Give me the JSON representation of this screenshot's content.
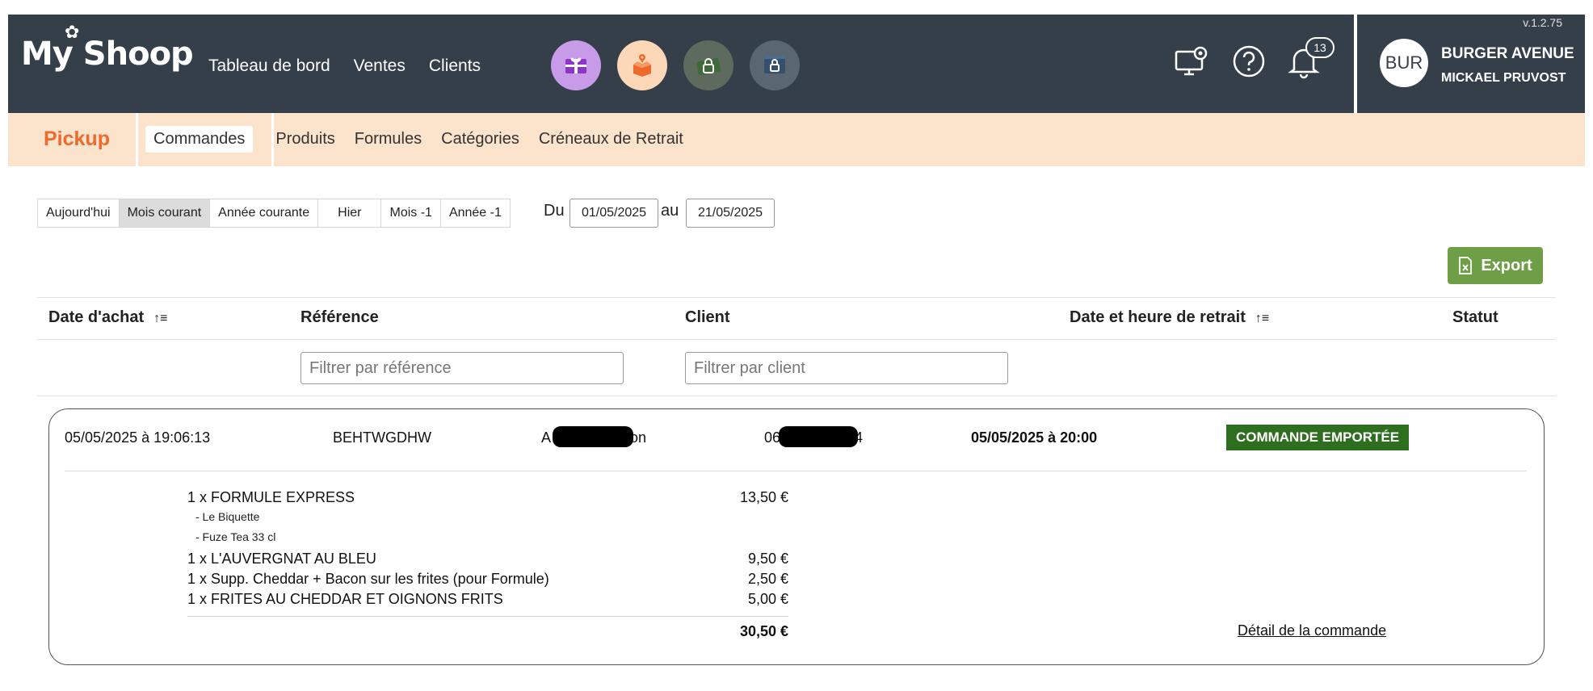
{
  "header": {
    "logo": "My Shoop",
    "nav": [
      "Tableau de bord",
      "Ventes",
      "Clients"
    ],
    "quick_icons": [
      "gift-card-icon",
      "delivery-box-icon",
      "locked-cash-icon",
      "locked-screen-icon"
    ],
    "tool_icons": [
      "monitor-settings-icon",
      "help-icon",
      "bell-icon"
    ],
    "notification_count": "13",
    "version": "v.1.2.75",
    "avatar": "BUR",
    "store_name": "BURGER AVENUE",
    "user_name": "MICKAEL PRUVOST"
  },
  "subnav": {
    "module": "Pickup",
    "items": [
      "Commandes",
      "Produits",
      "Formules",
      "Catégories",
      "Créneaux de Retrait"
    ],
    "active": "Commandes"
  },
  "period": {
    "options": [
      "Aujourd'hui",
      "Mois courant",
      "Année courante",
      "Hier",
      "Mois -1",
      "Année -1"
    ],
    "active": "Mois courant",
    "from_label": "Du",
    "from": "01/05/2025",
    "to_label": "au",
    "to": "21/05/2025"
  },
  "export_label": "Export",
  "table": {
    "columns": [
      "Date d'achat",
      "Référence",
      "Client",
      "Date et heure de retrait",
      "Statut"
    ],
    "filter_reference_placeholder": "Filtrer par référence",
    "filter_client_placeholder": "Filtrer par client"
  },
  "order": {
    "purchase_date": "05/05/2025 à 19:06:13",
    "reference": "BEHTWGDHW",
    "client_prefix": "A",
    "client_suffix": "on",
    "phone_prefix": "06",
    "phone_suffix": "4",
    "pickup_datetime": "05/05/2025 à 20:00",
    "status": "COMMANDE EMPORTÉE",
    "status_color": "#2e6e1f",
    "items": [
      {
        "label": "1 x FORMULE EXPRESS",
        "price": "13,50 €",
        "options": [
          "- Le Biquette",
          "- Fuze Tea 33 cl"
        ]
      },
      {
        "label": "1 x L'AUVERGNAT AU BLEU",
        "price": "9,50 €",
        "options": []
      },
      {
        "label": "1 x Supp. Cheddar + Bacon sur les frites (pour Formule)",
        "price": "2,50 €",
        "options": []
      },
      {
        "label": "1 x FRITES AU CHEDDAR ET OIGNONS FRITS",
        "price": "5,00 €",
        "options": []
      }
    ],
    "total": "30,50 €",
    "detail_link": "Détail de la commande"
  }
}
